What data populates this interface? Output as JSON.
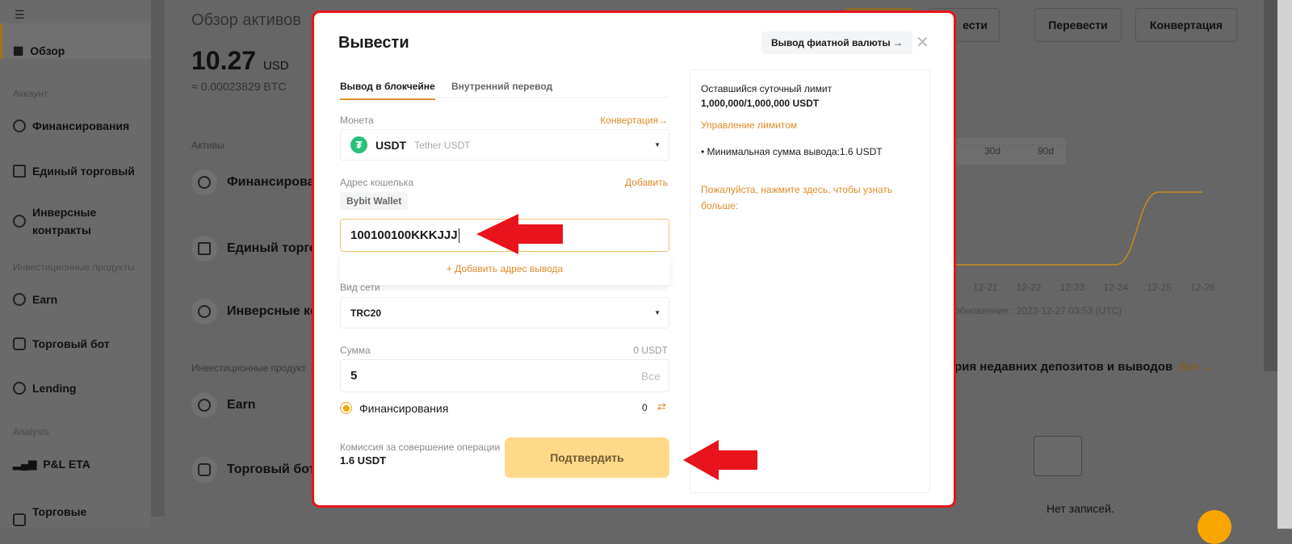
{
  "sidebar": {
    "overview": "Обзор",
    "sec_account": "Аккаунт",
    "funding": "Финансирования",
    "unified": "Единый торговый",
    "inverse": "Инверсные контракты",
    "sec_invest": "Инвестиционные продукты",
    "earn": "Earn",
    "bot": "Торговый бот",
    "lending": "Lending",
    "sec_analysis": "Analysis",
    "pnl": "P&L ETA",
    "trading": "Торговые"
  },
  "main": {
    "title": "Обзор активов",
    "balance": "10.27",
    "currency": "USD",
    "btc": "≈ 0.00023829 BTC",
    "assets_label": "Активы",
    "assets": [
      "Финансирова",
      "Единый торго",
      "Инверсные ко"
    ],
    "invest_label": "Инвестиционные продукт",
    "invest": [
      "Earn",
      "Торговый бот"
    ],
    "buttons": [
      "ести",
      "Перевести",
      "Конвертация"
    ],
    "periods": [
      "30d",
      "90d"
    ],
    "chart_dates": [
      "12-21",
      "12-22",
      "12-23",
      "12-24",
      "12-25",
      "12-26"
    ],
    "updated": "обновление:: 2023-12-27 03:53 (UTC)",
    "history_title": "рия недавних депозитов и выводов",
    "all_link": "Все",
    "no_records": "Нет записей."
  },
  "chart_data": {
    "type": "line",
    "x": [
      "12-21",
      "12-22",
      "12-23",
      "12-24",
      "12-25",
      "12-26"
    ],
    "values": [
      0,
      0,
      0,
      0,
      10.27,
      10.27
    ],
    "color": "#c98a1a"
  },
  "modal": {
    "title": "Вывести",
    "fiat_btn": "Вывод фиатной валюты →",
    "tabs": [
      "Вывод в блокчейне",
      "Внутренний перевод"
    ],
    "coin_label": "Монета",
    "convert_link": "Конвертация→",
    "coin": "USDT",
    "coin_name": "Tether USDT",
    "addr_label": "Адрес кошелька",
    "add_link": "Добавить",
    "wallet_tag": "Bybit Wallet",
    "address": "100100100KKKJJJ",
    "add_address": "+  Добавить адрес вывода",
    "network_label": "Вид сети",
    "network": "TRC20",
    "amount_label": "Сумма",
    "available": "0 USDT",
    "amount": "5",
    "all": "Все",
    "source": "Финансирования",
    "source_balance": "0",
    "fee_label": "Комиссия за совершение операции",
    "fee": "1.6 USDT",
    "confirm": "Подтвердить",
    "limit_label": "Оставшийся суточный лимит",
    "limit": "1,000,000/1,000,000 USDT",
    "manage_limit": "Управление лимитом",
    "min_withdraw": "• Минимальная сумма вывода:1.6 USDT",
    "learn_more": "Пожалуйста, нажмите здесь, чтобы узнать больше:"
  },
  "colors": {
    "accent": "#f7a600",
    "usdt": "#26c07a",
    "annotation": "#e8131c"
  }
}
